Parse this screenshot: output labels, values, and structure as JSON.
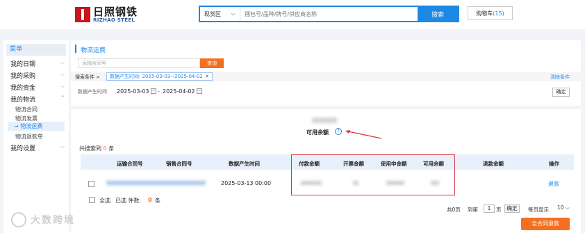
{
  "header": {
    "logo_cn": "日照钢铁",
    "logo_en": "RIZHAO STEEL",
    "search_scope": "现货区",
    "search_placeholder": "捆包号/品种/牌号/供应商名称",
    "search_button": "搜索",
    "cart_label": "购物车",
    "cart_count": "(15)"
  },
  "menu": {
    "title": "菜单",
    "groups": [
      "我的日钢",
      "我的采购",
      "我的资金",
      "我的物流",
      "我的设置"
    ],
    "logistics_items": [
      "物流合同",
      "物流发票",
      "物流运费",
      "物流退款单"
    ]
  },
  "filter": {
    "page_title": "物流运费",
    "transport_placeholder": "运输合同号",
    "query_button": "查询",
    "cond_label": "搜索条件 >",
    "cond_tag": "数据产生时间: 2025-03-03~2025-04-02",
    "cond_tag_close": "✕",
    "clear_link": "清除条件",
    "date_label": "数据产生时间",
    "date_start": "2025-03-03",
    "date_sep": "-",
    "date_end": "2025-04-02",
    "confirm_button": "确定"
  },
  "summary": {
    "available_label": "可用余额",
    "help_glyph": "?"
  },
  "table": {
    "found_prefix": "共搜索到",
    "found_count": "0",
    "found_suffix": "条",
    "headers": [
      "运输合同号",
      "销售合同号",
      "数据产生时间",
      "付款金额",
      "开票金额",
      "使用中金额",
      "可用余额",
      "退款金额",
      "操作"
    ],
    "rows": [
      {
        "created_time": "2025-03-13 00:00",
        "action": "退款"
      }
    ]
  },
  "footer": {
    "select_all": "全选",
    "selected_label": "已选 件数:",
    "selected_count": "0",
    "selected_unit": "条",
    "total_pages": "共0页",
    "goto_label": "到第",
    "page_input": "1",
    "page_unit": "页",
    "goto_button": "确定",
    "per_page_label": "每页显示",
    "per_page_value": "10",
    "refund_all_button": "全合同退款"
  },
  "watermark": {
    "text": "大数跨境"
  },
  "colors": {
    "accent": "#1e88e5",
    "orange": "#f36f21",
    "brand_red": "#c8161d",
    "highlight_red": "#d9363e"
  }
}
